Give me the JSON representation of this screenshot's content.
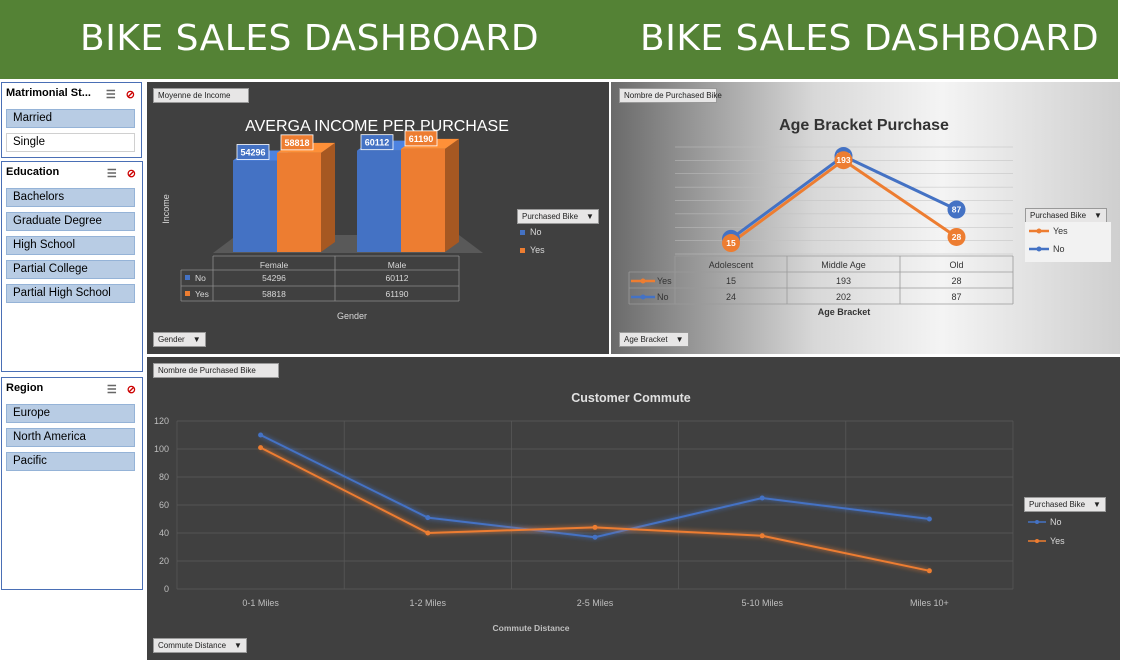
{
  "banner": {
    "title_left": "BIKE SALES DASHBOARD",
    "title_right": "BIKE SALES DASHBOARD",
    "color": "#548235"
  },
  "slicers": {
    "marital": {
      "title": "Matrimonial St...",
      "items": [
        "Married",
        "Single"
      ],
      "selected": [
        "Married"
      ]
    },
    "education": {
      "title": "Education",
      "items": [
        "Bachelors",
        "Graduate Degree",
        "High School",
        "Partial College",
        "Partial High School"
      ]
    },
    "region": {
      "title": "Region",
      "items": [
        "Europe",
        "North America",
        "Pacific"
      ]
    }
  },
  "icons": {
    "multi_select": "multi-select-icon",
    "clear_filter": "clear-filter-icon"
  },
  "income_chart": {
    "field_pill": "Moyenne de Income",
    "axis_pill": "Gender",
    "legend_pill": "Purchased Bike",
    "ylabel": "Income",
    "xlabel": "Gender",
    "chart_data": {
      "type": "bar",
      "title": "AVERGA INCOME PER PURCHASE",
      "categories": [
        "Female",
        "Male"
      ],
      "series": [
        {
          "name": "No",
          "values": [
            54296,
            60112
          ],
          "color": "#4472c4"
        },
        {
          "name": "Yes",
          "values": [
            58818,
            61190
          ],
          "color": "#ed7d31"
        }
      ]
    }
  },
  "age_chart": {
    "field_pill": "Nombre de Purchased Bike",
    "axis_pill": "Age Bracket",
    "legend_pill": "Purchased Bike",
    "xlabel": "Age Bracket",
    "chart_data": {
      "type": "line",
      "title": "Age Bracket Purchase",
      "categories": [
        "Adolescent",
        "Middle Age",
        "Old"
      ],
      "series": [
        {
          "name": "Yes",
          "values": [
            15,
            193,
            28
          ],
          "color": "#ed7d31"
        },
        {
          "name": "No",
          "values": [
            24,
            202,
            87
          ],
          "color": "#4472c4"
        }
      ]
    }
  },
  "commute_chart": {
    "field_pill": "Nombre de Purchased Bike",
    "axis_pill": "Commute Distance",
    "legend_pill": "Purchased Bike",
    "xlabel": "Commute Distance",
    "chart_data": {
      "type": "line",
      "title": "Customer Commute",
      "categories": [
        "0-1 Miles",
        "1-2 Miles",
        "2-5 Miles",
        "5-10 Miles",
        "Miles 10+"
      ],
      "ylim": [
        0,
        120
      ],
      "yticks": [
        0,
        20,
        40,
        60,
        80,
        100,
        120
      ],
      "series": [
        {
          "name": "No",
          "values": [
            110,
            51,
            37,
            65,
            50
          ],
          "color": "#4472c4"
        },
        {
          "name": "Yes",
          "values": [
            101,
            40,
            44,
            38,
            13
          ],
          "color": "#ed7d31"
        }
      ]
    }
  }
}
